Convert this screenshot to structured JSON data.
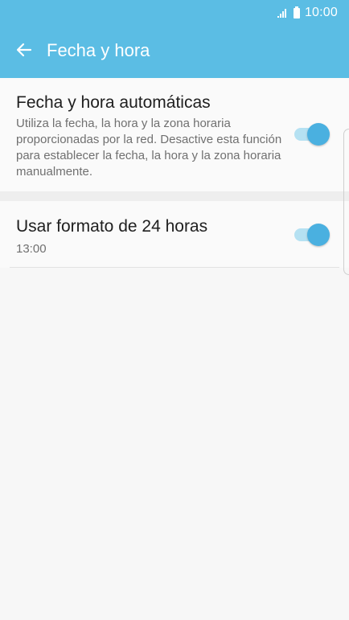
{
  "status_bar": {
    "time": "10:00",
    "signal_icon": "signal-icon",
    "battery_icon": "battery-icon"
  },
  "header": {
    "back_icon": "arrow-left-icon",
    "title": "Fecha y hora",
    "color": "#5bbde4"
  },
  "settings": [
    {
      "title": "Fecha y hora automáticas",
      "description": "Utiliza la fecha, la hora y la zona horaria proporcionadas por la red. Desactive esta función para establecer la fecha, la hora y la zona horaria manualmente.",
      "toggle_on": true
    },
    {
      "title": "Usar formato de 24 horas",
      "description": "13:00",
      "toggle_on": true
    }
  ],
  "colors": {
    "accent": "#4ab0e0",
    "toggle_track": "#b5e1f2"
  }
}
